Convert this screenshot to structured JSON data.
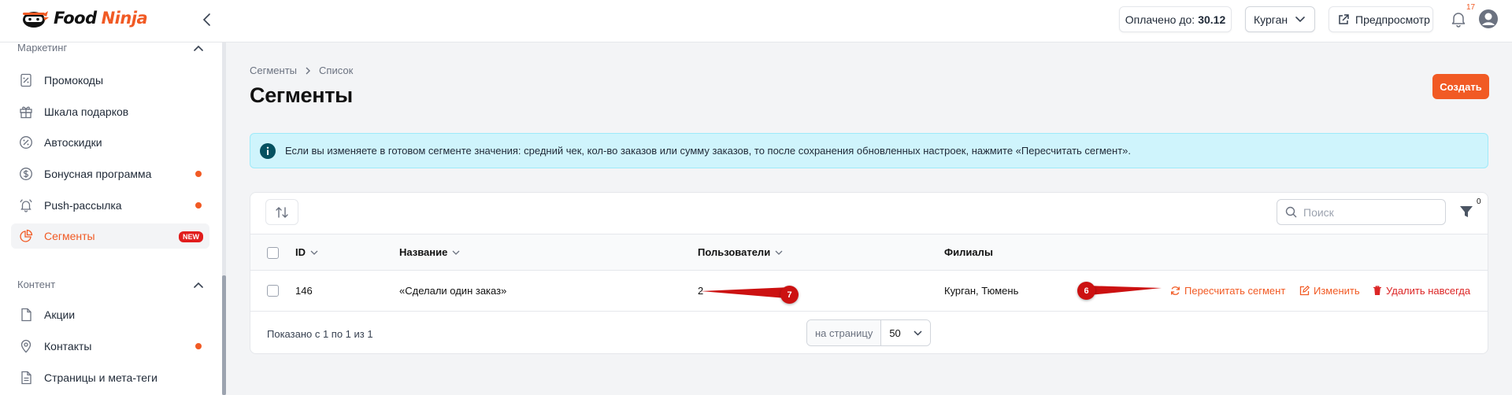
{
  "brand": {
    "word1": "Food",
    "word2": "Ninja",
    "accent": "#f15a24"
  },
  "header": {
    "paid_label": "Оплачено до:",
    "paid_date": "30.12",
    "city": "Курган",
    "preview_label": "Предпросмотр",
    "notifications_count": "17"
  },
  "sidebar": {
    "sections": [
      {
        "title": "Маркетинг",
        "items": [
          {
            "label": "Промокоды",
            "icon": "percent-receipt-icon"
          },
          {
            "label": "Шкала подарков",
            "icon": "gift-icon"
          },
          {
            "label": "Автоскидки",
            "icon": "discount-icon"
          },
          {
            "label": "Бонусная программа",
            "icon": "dollar-icon",
            "dot": true
          },
          {
            "label": "Push-рассылка",
            "icon": "bell-icon",
            "dot": true
          },
          {
            "label": "Сегменты",
            "icon": "pie-chart-icon",
            "active": true,
            "badge": "NEW"
          }
        ]
      },
      {
        "title": "Контент",
        "items": [
          {
            "label": "Акции",
            "icon": "document-icon"
          },
          {
            "label": "Контакты",
            "icon": "map-pin-icon",
            "dot": true
          },
          {
            "label": "Страницы и мета-теги",
            "icon": "document-icon"
          }
        ]
      }
    ]
  },
  "breadcrumb": {
    "parent": "Сегменты",
    "current": "Список"
  },
  "page": {
    "title": "Сегменты",
    "create_label": "Создать"
  },
  "alert": {
    "text": "Если вы изменяете в готовом сегменте значения: средний чек, кол-во заказов или сумму заказов, то после сохранения обновленных настроек, нажмите «Пересчитать сегмент»."
  },
  "toolbar": {
    "search_placeholder": "Поиск",
    "filter_count": "0"
  },
  "table": {
    "columns": {
      "id": "ID",
      "name": "Название",
      "users": "Пользователи",
      "branches": "Филиалы"
    },
    "rows": [
      {
        "id": "146",
        "name": "«Сделали один заказ»",
        "users": "2",
        "branches": "Курган, Тюмень",
        "actions": {
          "recalc": "Пересчитать сегмент",
          "edit": "Изменить",
          "delete": "Удалить навсегда"
        }
      }
    ]
  },
  "pagination": {
    "info": "Показано с 1 по 1 из 1",
    "per_page_label": "на страницу",
    "per_page_value": "50"
  },
  "annotations": [
    {
      "label": "7"
    },
    {
      "label": "6"
    }
  ]
}
